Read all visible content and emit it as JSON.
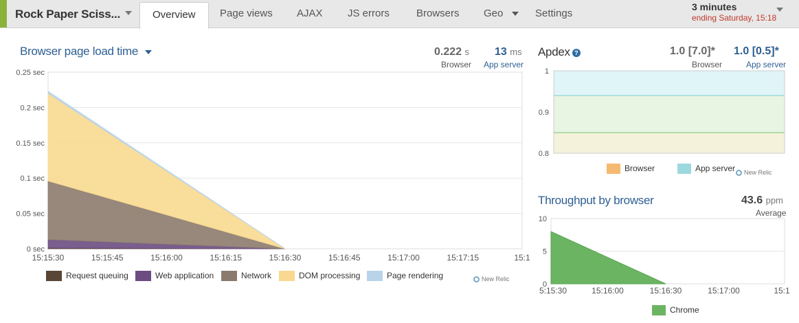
{
  "header": {
    "app_name": "Rock Paper Sciss...",
    "tabs": [
      "Overview",
      "Page views",
      "AJAX",
      "JS errors",
      "Browsers",
      "Geo",
      "Settings"
    ],
    "active_tab": "Overview",
    "time_range": "3 minutes",
    "time_ending": "ending Saturday, 15:18"
  },
  "load_panel": {
    "title": "Browser page load time",
    "browser_value": "0.222",
    "browser_unit": "s",
    "browser_label": "Browser",
    "app_value": "13",
    "app_unit": "ms",
    "app_label": "App server",
    "legend": [
      "Request queuing",
      "Web application",
      "Network",
      "DOM processing",
      "Page rendering"
    ],
    "attribution": "New Relic"
  },
  "apdex_panel": {
    "title": "Apdex",
    "browser_score": "1.0 [7.0]*",
    "browser_label": "Browser",
    "app_score": "1.0 [0.5]*",
    "app_label": "App server",
    "legend": [
      "Browser",
      "App server"
    ],
    "attribution": "New Relic"
  },
  "throughput_panel": {
    "title": "Throughput by browser",
    "value": "43.6",
    "unit": "ppm",
    "sub_label": "Average",
    "legend": [
      "Chrome"
    ]
  },
  "colors": {
    "request_queuing": "#5a4636",
    "web_application": "#6b4d82",
    "network": "#8c7b6d",
    "dom_processing": "#f8d98f",
    "page_rendering": "#b9d4e8",
    "browser_apdex": "#f5b971",
    "app_server_apdex": "#9ed8df",
    "chrome": "#6bb562",
    "title_blue": "#2e5f92",
    "time_red": "#c0392b"
  },
  "chart_data": [
    {
      "type": "area",
      "title": "Browser page load time",
      "x": [
        "15:15:30",
        "15:16:30"
      ],
      "xticks": [
        "15:15:30",
        "15:15:45",
        "15:16:00",
        "15:16:15",
        "15:16:30",
        "15:16:45",
        "15:17:00",
        "15:17:15",
        "15:1"
      ],
      "yticks": [
        "0 sec",
        "0.05 sec",
        "0.1 sec",
        "0.15 sec",
        "0.2 sec",
        "0.25 sec"
      ],
      "ylim": [
        0,
        0.25
      ],
      "stacked": true,
      "grid": true,
      "series": [
        {
          "name": "Request queuing",
          "values": [
            0.001,
            0
          ]
        },
        {
          "name": "Web application",
          "values": [
            0.012,
            0
          ]
        },
        {
          "name": "Network",
          "values": [
            0.083,
            0
          ]
        },
        {
          "name": "DOM processing",
          "values": [
            0.124,
            0
          ]
        },
        {
          "name": "Page rendering",
          "values": [
            0.003,
            0
          ]
        }
      ]
    },
    {
      "type": "area",
      "title": "Apdex",
      "yticks": [
        "0.8",
        "0.9",
        "1"
      ],
      "ylim": [
        0.8,
        1.0
      ],
      "grid": true,
      "bands": [
        {
          "name": "Browser",
          "from": 0.8,
          "to": 0.85
        },
        {
          "name": "App server",
          "from": 0.85,
          "to": 1.0
        }
      ],
      "lines": [
        {
          "name": "App server threshold",
          "value": 0.94
        },
        {
          "name": "Browser threshold",
          "value": 0.85
        }
      ]
    },
    {
      "type": "area",
      "title": "Throughput by browser",
      "x": [
        "15:15:30",
        "15:16:30"
      ],
      "xticks": [
        "5:15:30",
        "15:16:00",
        "15:16:30",
        "15:17:00",
        "15:1"
      ],
      "yticks": [
        "0",
        "5",
        "10"
      ],
      "ylim": [
        0,
        10
      ],
      "grid": true,
      "series": [
        {
          "name": "Chrome",
          "values": [
            8,
            0
          ]
        }
      ]
    }
  ]
}
